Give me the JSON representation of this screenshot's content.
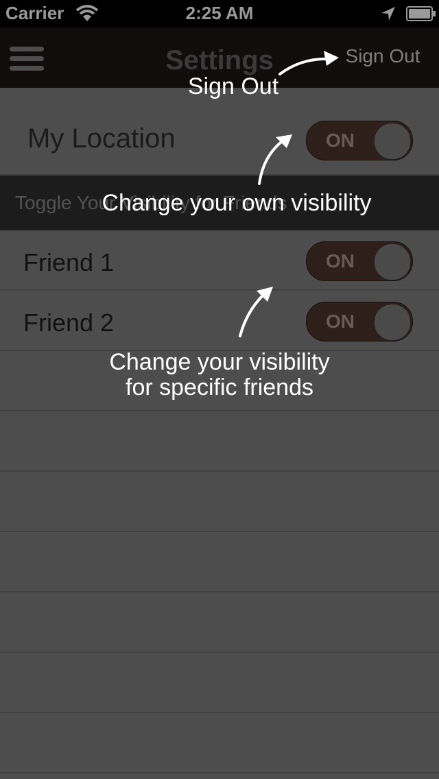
{
  "status_bar": {
    "carrier": "Carrier",
    "time": "2:25 AM"
  },
  "nav": {
    "title": "Settings",
    "sign_out": "Sign Out"
  },
  "location_row": {
    "label": "My Location",
    "toggle": "ON"
  },
  "section": {
    "label": "Toggle Your Visibility for Friends"
  },
  "friends": [
    {
      "name": "Friend 1",
      "toggle": "ON"
    },
    {
      "name": "Friend 2",
      "toggle": "ON"
    }
  ],
  "tutorial": {
    "sign_out": "Sign Out",
    "own_visibility": "Change your own visibility",
    "friends_visibility_line1": "Change your visibility",
    "friends_visibility_line2": "for specific friends"
  },
  "colors": {
    "overlay": "#4d4d4d",
    "navbar": "#120d0d",
    "toggle_track": "#2e1f1b"
  }
}
